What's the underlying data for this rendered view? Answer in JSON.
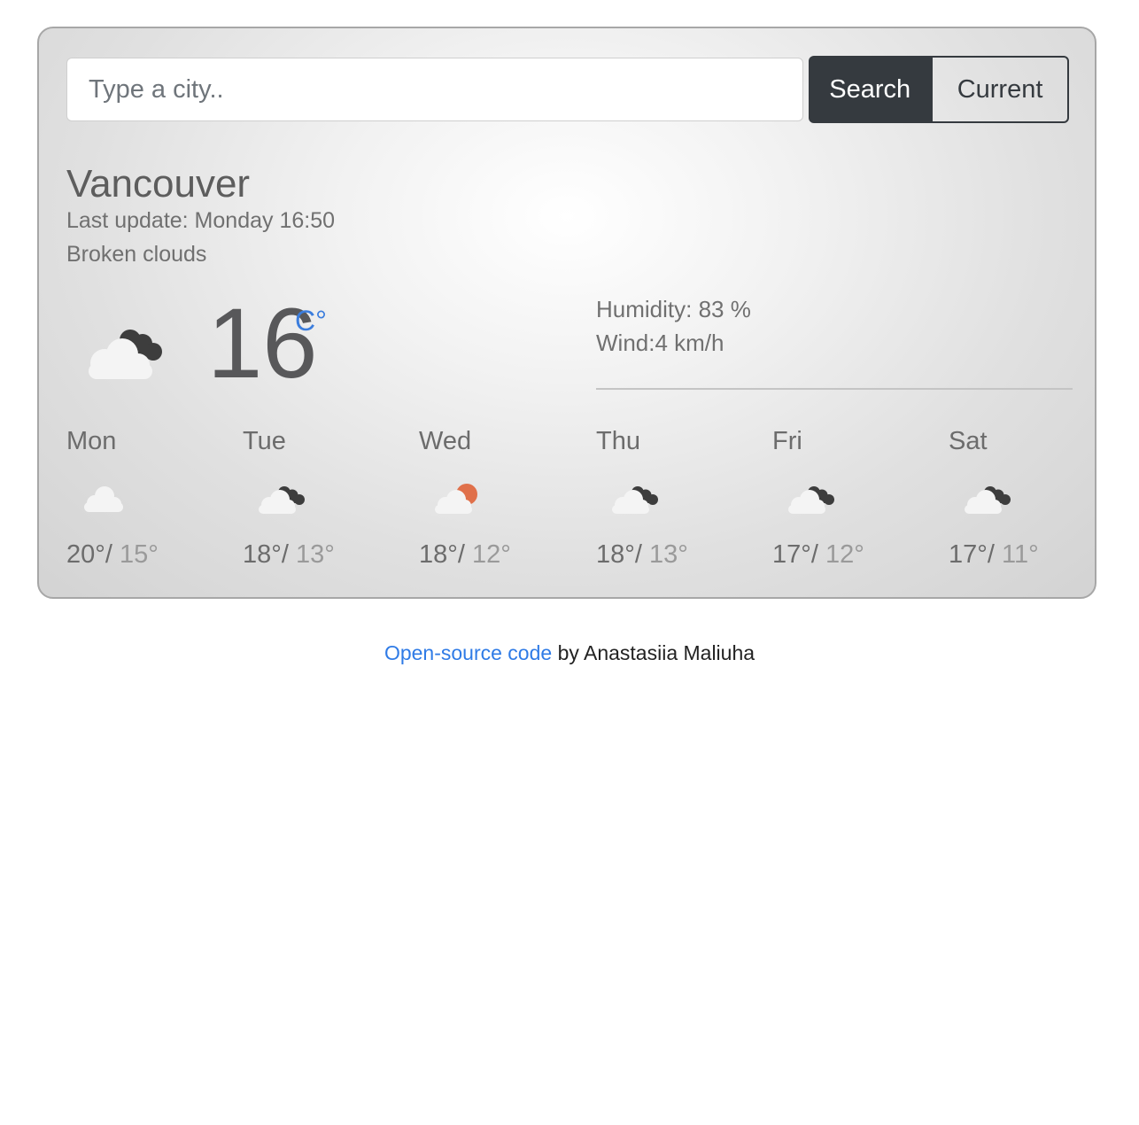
{
  "search": {
    "placeholder": "Type a city..",
    "search_label": "Search",
    "current_label": "Current"
  },
  "weather": {
    "city": "Vancouver",
    "last_update": "Last update: Monday 16:50",
    "description": "Broken clouds",
    "icon": "broken-clouds-icon",
    "temperature": "16",
    "unit": "C°",
    "humidity": "Humidity: 83 %",
    "wind": "Wind:4 km/h"
  },
  "forecast": [
    {
      "day": "Mon",
      "icon": "few-clouds-icon",
      "max": "20°/",
      "min": " 15°"
    },
    {
      "day": "Tue",
      "icon": "broken-clouds-icon",
      "max": "18°/",
      "min": " 13°"
    },
    {
      "day": "Wed",
      "icon": "partly-sunny-icon",
      "max": "18°/",
      "min": " 12°"
    },
    {
      "day": "Thu",
      "icon": "broken-clouds-icon",
      "max": "18°/",
      "min": " 13°"
    },
    {
      "day": "Fri",
      "icon": "broken-clouds-icon",
      "max": "17°/",
      "min": " 12°"
    },
    {
      "day": "Sat",
      "icon": "broken-clouds-icon",
      "max": "17°/",
      "min": " 11°"
    }
  ],
  "footer": {
    "link_text": "Open-source code",
    "author_text": " by Anastasiia Maliuha"
  },
  "colors": {
    "accent": "#3b7ddd",
    "button_dark": "#353a3f",
    "sun": "#e0704a"
  }
}
